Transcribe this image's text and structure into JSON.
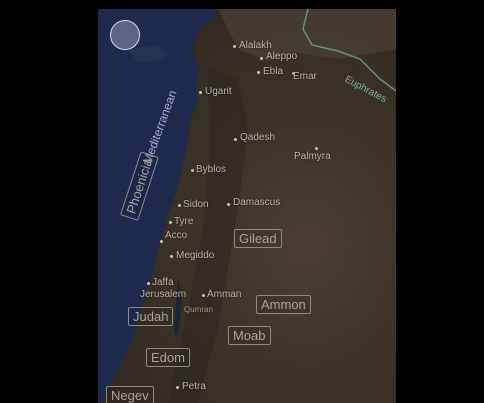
{
  "map": {
    "sea_label": "Mediterranean",
    "river_label": "Euphrates",
    "cities": [
      {
        "name": "Alalakh",
        "kind": "city"
      },
      {
        "name": "Aleppo",
        "kind": "city"
      },
      {
        "name": "Ebla",
        "kind": "city"
      },
      {
        "name": "Emar",
        "kind": "city"
      },
      {
        "name": "Ugarit",
        "kind": "city"
      },
      {
        "name": "Qadesh",
        "kind": "city"
      },
      {
        "name": "Palmyra",
        "kind": "city"
      },
      {
        "name": "Byblos",
        "kind": "city"
      },
      {
        "name": "Sidon",
        "kind": "city"
      },
      {
        "name": "Damascus",
        "kind": "city"
      },
      {
        "name": "Tyre",
        "kind": "city"
      },
      {
        "name": "Acco",
        "kind": "city"
      },
      {
        "name": "Megiddo",
        "kind": "city"
      },
      {
        "name": "Jaffa",
        "kind": "city"
      },
      {
        "name": "Jerusalem",
        "kind": "city"
      },
      {
        "name": "Amman",
        "kind": "city"
      },
      {
        "name": "Qumran",
        "kind": "site"
      },
      {
        "name": "Petra",
        "kind": "city"
      }
    ],
    "regions": [
      "Phoenicia",
      "Gilead",
      "Ammon",
      "Judah",
      "Moab",
      "Edom",
      "Negev"
    ],
    "colors": {
      "sea": "#1d2a4e",
      "land": "#3a3126",
      "label": "#bcb6ae",
      "region_border": "#8e8a84",
      "river": "#7fb0a8"
    }
  },
  "controls": {
    "locate_button_icon": "location-circle-icon"
  }
}
